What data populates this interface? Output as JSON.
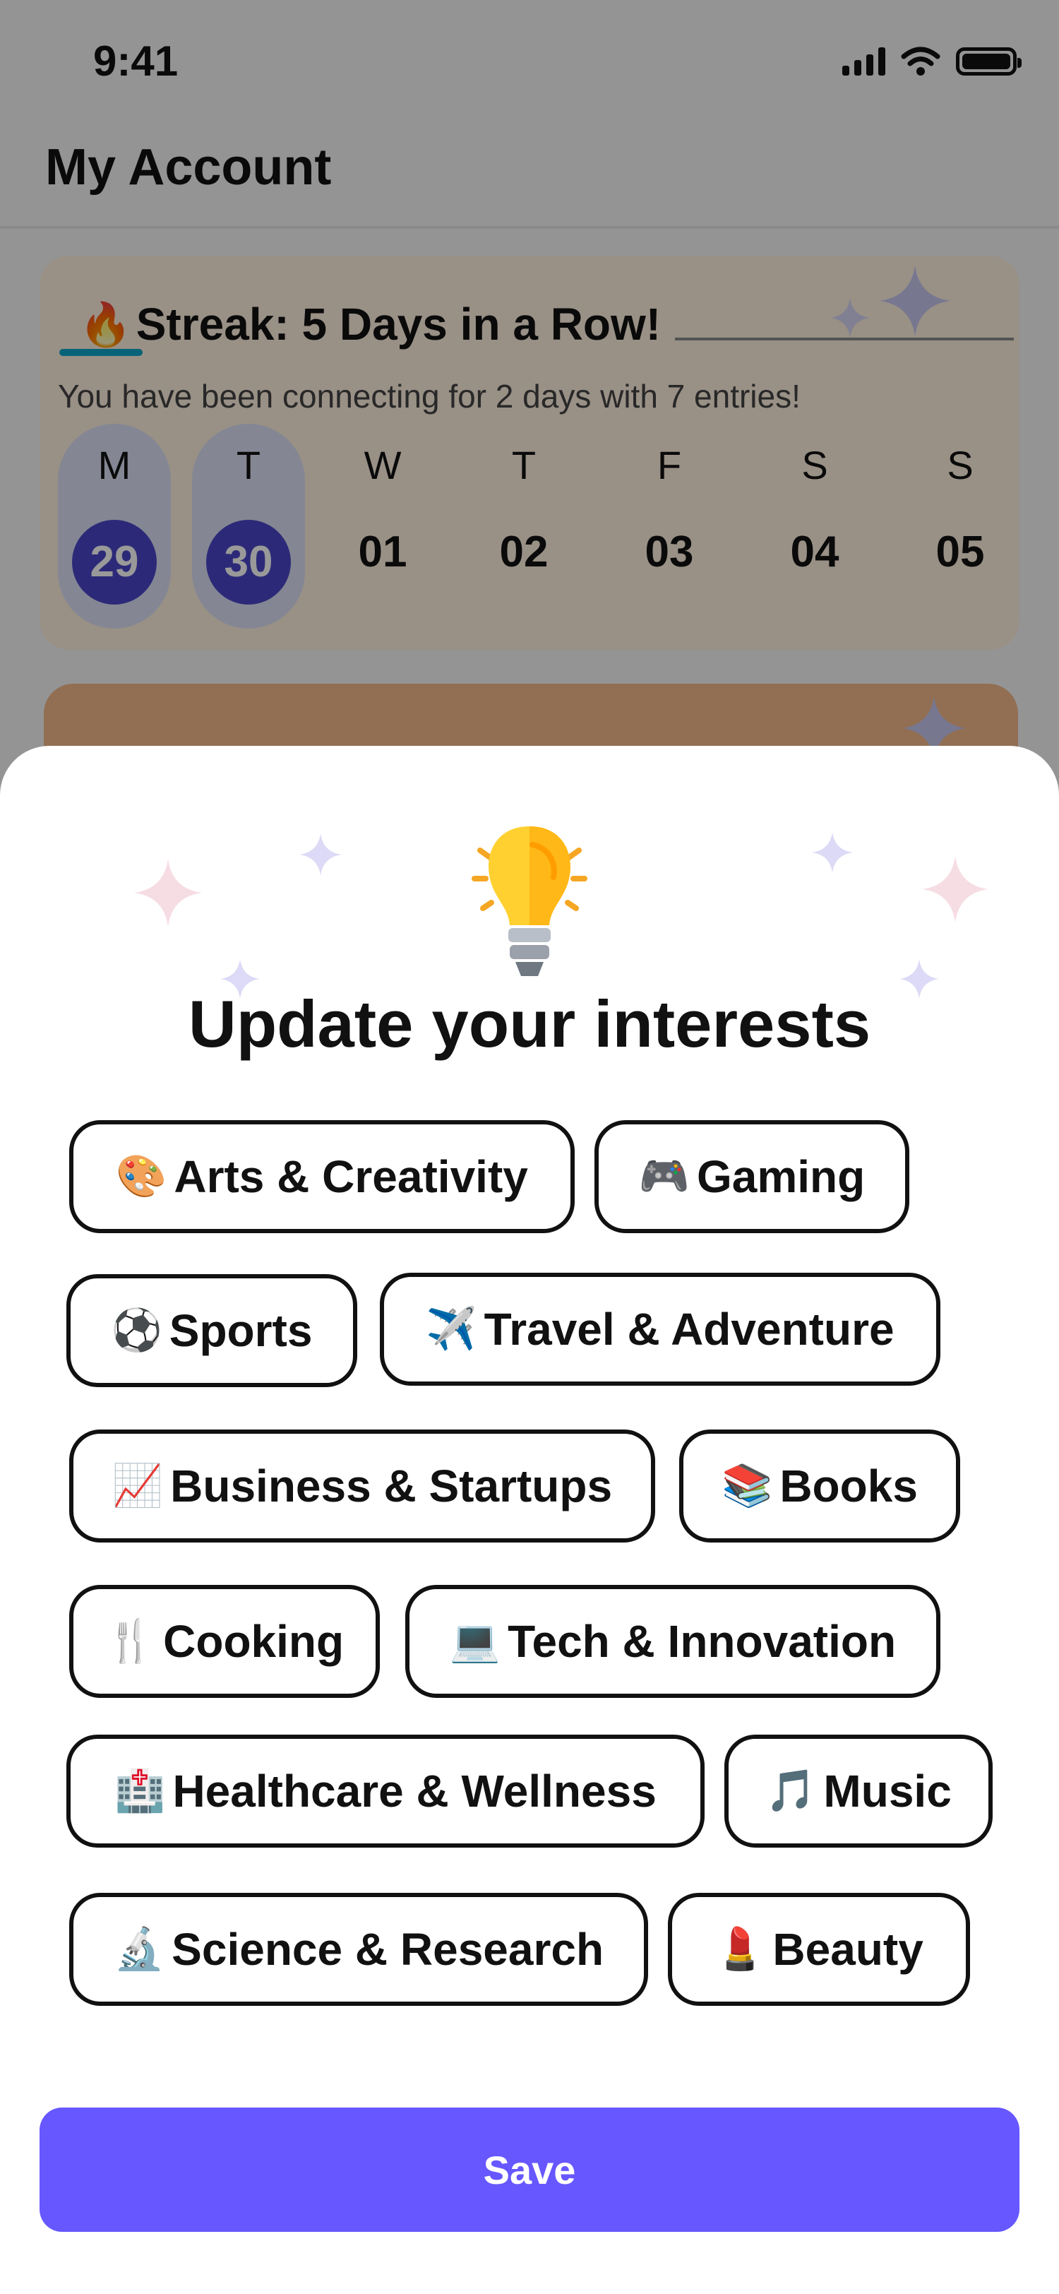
{
  "status_bar": {
    "time": "9:41"
  },
  "page": {
    "title": "My Account"
  },
  "streak_card": {
    "flame_icon": "🔥",
    "title": "Streak: 5 Days in a Row!",
    "subtitle": "You have been connecting for 2 days with 7 entries!",
    "days": [
      {
        "letter": "M",
        "date": "29",
        "active": true
      },
      {
        "letter": "T",
        "date": "30",
        "active": true
      },
      {
        "letter": "W",
        "date": "01",
        "active": false
      },
      {
        "letter": "T",
        "date": "02",
        "active": false
      },
      {
        "letter": "F",
        "date": "03",
        "active": false
      },
      {
        "letter": "S",
        "date": "04",
        "active": false
      },
      {
        "letter": "S",
        "date": "05",
        "active": false
      }
    ]
  },
  "sheet": {
    "title": "Update your interests",
    "icon": "lightbulb-icon",
    "interests": [
      {
        "emoji": "🎨",
        "label": "Arts & Creativity"
      },
      {
        "emoji": "🎮",
        "label": "Gaming"
      },
      {
        "emoji": "⚽",
        "label": "Sports"
      },
      {
        "emoji": "✈️",
        "label": "Travel & Adventure"
      },
      {
        "emoji": "📈",
        "label": "Business & Startups"
      },
      {
        "emoji": "📚",
        "label": "Books"
      },
      {
        "emoji": "🍴",
        "label": "Cooking"
      },
      {
        "emoji": "💻",
        "label": "Tech & Innovation"
      },
      {
        "emoji": "🏥",
        "label": "Healthcare & Wellness"
      },
      {
        "emoji": "🎵",
        "label": "Music"
      },
      {
        "emoji": "🔬",
        "label": "Science & Research"
      },
      {
        "emoji": "💄",
        "label": "Beauty"
      }
    ],
    "save_label": "Save"
  },
  "colors": {
    "accent": "#6657ff",
    "active_day": "#4a47c9",
    "streak_card_bg": "#fff1df",
    "chip_border": "#111111"
  }
}
